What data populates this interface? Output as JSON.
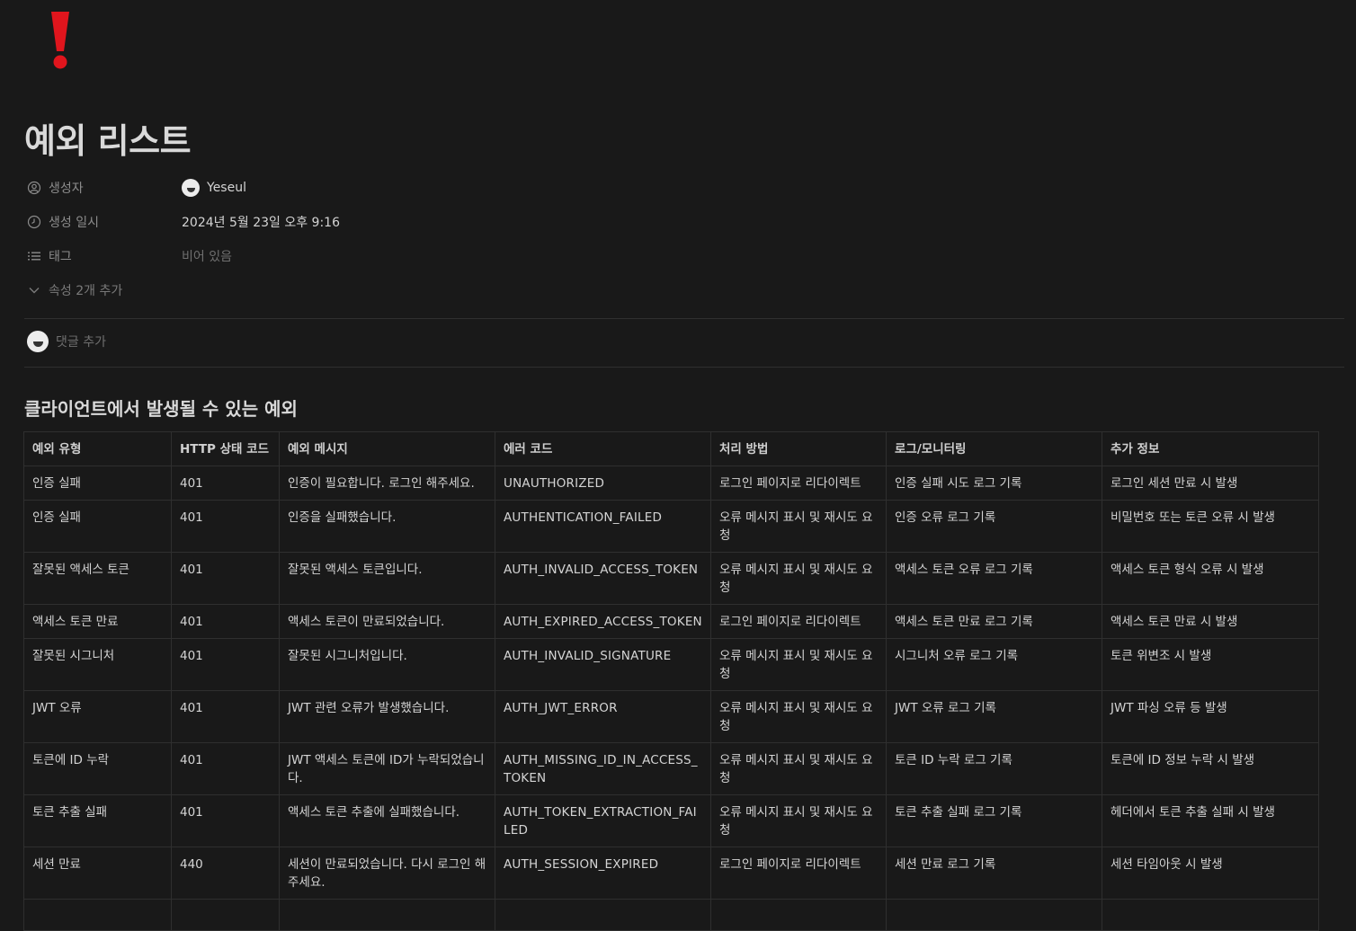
{
  "page": {
    "title": "예외 리스트",
    "icon": "exclamation-icon",
    "accent_color": "#e0151d"
  },
  "properties": {
    "created_by": {
      "label": "생성자",
      "value": "Yeseul"
    },
    "created_time": {
      "label": "생성 일시",
      "value": "2024년 5월 23일 오후 9:16"
    },
    "tags": {
      "label": "태그",
      "value": "비어 있음"
    },
    "more": {
      "label": "속성 2개 추가"
    }
  },
  "comment": {
    "placeholder": "댓글 추가"
  },
  "section": {
    "heading": "클라이언트에서 발생될 수 있는 예외"
  },
  "table": {
    "headers": [
      "예외 유형",
      "HTTP 상태 코드",
      "예외 메시지",
      "에러 코드",
      "처리 방법",
      "로그/모니터링",
      "추가 정보"
    ],
    "rows": [
      [
        "인증 실패",
        "401",
        "인증이 필요합니다. 로그인 해주세요.",
        "UNAUTHORIZED",
        "로그인 페이지로 리다이렉트",
        "인증 실패 시도 로그 기록",
        "로그인 세션 만료 시 발생"
      ],
      [
        "인증 실패",
        "401",
        "인증을 실패했습니다.",
        "AUTHENTICATION_FAILED",
        "오류 메시지 표시 및 재시도 요청",
        "인증 오류 로그 기록",
        "비밀번호 또는 토큰 오류 시 발생"
      ],
      [
        "잘못된 액세스 토큰",
        "401",
        "잘못된 액세스 토큰입니다.",
        "AUTH_INVALID_ACCESS_TOKEN",
        "오류 메시지 표시 및 재시도 요청",
        "액세스 토큰 오류 로그 기록",
        "액세스 토큰 형식 오류 시 발생"
      ],
      [
        "액세스 토큰 만료",
        "401",
        "액세스 토큰이 만료되었습니다.",
        "AUTH_EXPIRED_ACCESS_TOKEN",
        "로그인 페이지로 리다이렉트",
        "액세스 토큰 만료 로그 기록",
        "액세스 토큰 만료 시 발생"
      ],
      [
        "잘못된 시그니처",
        "401",
        "잘못된 시그니처입니다.",
        "AUTH_INVALID_SIGNATURE",
        "오류 메시지 표시 및 재시도 요청",
        "시그니처 오류 로그 기록",
        "토큰 위변조 시 발생"
      ],
      [
        "JWT 오류",
        "401",
        "JWT 관련 오류가 발생했습니다.",
        "AUTH_JWT_ERROR",
        "오류 메시지 표시 및 재시도 요청",
        "JWT 오류 로그 기록",
        "JWT 파싱 오류 등 발생"
      ],
      [
        "토큰에 ID 누락",
        "401",
        "JWT 액세스 토큰에 ID가 누락되었습니다.",
        "AUTH_MISSING_ID_IN_ACCESS_TOKEN",
        "오류 메시지 표시 및 재시도 요청",
        "토큰 ID 누락 로그 기록",
        "토큰에 ID 정보 누락 시 발생"
      ],
      [
        "토큰 추출 실패",
        "401",
        "액세스 토큰 추출에 실패했습니다.",
        "AUTH_TOKEN_EXTRACTION_FAILED",
        "오류 메시지 표시 및 재시도 요청",
        "토큰 추출 실패 로그 기록",
        "헤더에서 토큰 추출 실패 시 발생"
      ],
      [
        "세션 만료",
        "440",
        "세션이 만료되었습니다. 다시 로그인 해주세요.",
        "AUTH_SESSION_EXPIRED",
        "로그인 페이지로 리다이렉트",
        "세션 만료 로그 기록",
        "세션 타임아웃 시 발생"
      ],
      [
        "",
        "",
        "",
        "",
        "",
        "",
        ""
      ]
    ]
  }
}
